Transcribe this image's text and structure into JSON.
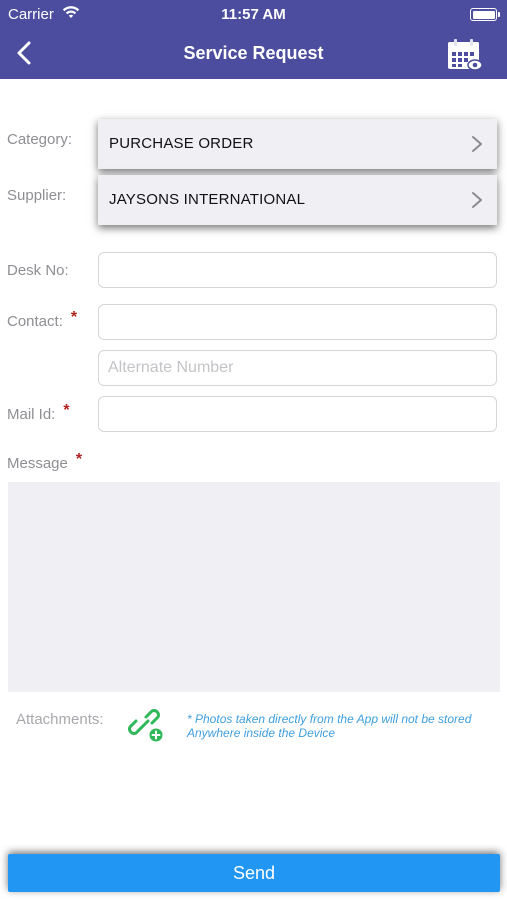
{
  "status_bar": {
    "carrier": "Carrier",
    "time": "11:57 AM"
  },
  "nav": {
    "title": "Service Request",
    "back_icon": "chevron-left-icon",
    "calendar_icon": "calendar-icon"
  },
  "form": {
    "category": {
      "label": "Category:",
      "value": "PURCHASE ORDER"
    },
    "supplier": {
      "label": "Supplier:",
      "value": "JAYSONS INTERNATIONAL"
    },
    "desk": {
      "label": "Desk No:",
      "value": ""
    },
    "contact": {
      "label": "Contact:",
      "required": "*",
      "value": ""
    },
    "alternate": {
      "placeholder": "Alternate Number",
      "value": ""
    },
    "mail": {
      "label": "Mail Id:",
      "required": "*",
      "value": ""
    },
    "message": {
      "label": "Message",
      "required": "*",
      "value": ""
    }
  },
  "attachments": {
    "label": "Attachments:",
    "icon": "link-add-icon",
    "note_line1": "* Photos taken directly from the App will not be stored",
    "note_line2": "Anywhere inside the Device"
  },
  "send_label": "Send",
  "colors": {
    "navbar": "#4c4d9e",
    "send": "#2196f3",
    "required": "#b22222",
    "note": "#3f9fde",
    "attach_icon": "#2fb85a"
  }
}
